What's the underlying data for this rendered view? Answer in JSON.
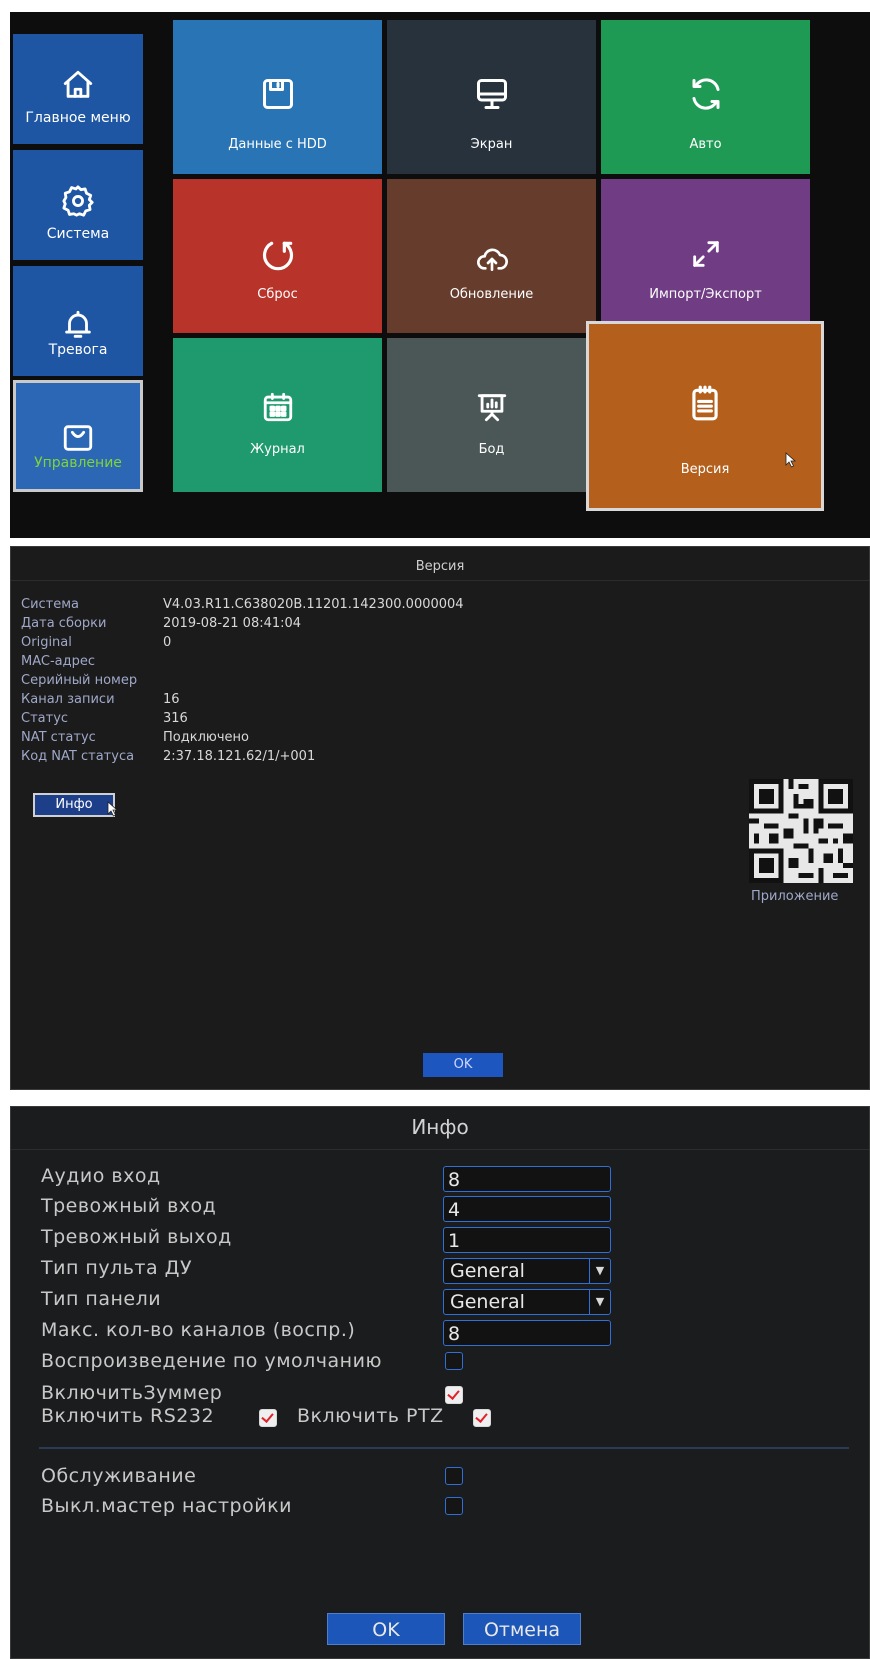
{
  "menu": {
    "sidebar": [
      {
        "label": "Главное меню",
        "icon": "home-icon"
      },
      {
        "label": "Система",
        "icon": "gear-icon"
      },
      {
        "label": "Тревога",
        "icon": "bell-icon"
      },
      {
        "label": "Управление",
        "icon": "bag-icon",
        "active": true
      }
    ],
    "tiles": [
      {
        "label": "Данные с HDD",
        "icon": "floppy-disk-icon",
        "color": "#2874b4"
      },
      {
        "label": "Экран",
        "icon": "monitor-icon",
        "color": "#27323d"
      },
      {
        "label": "Авто",
        "icon": "sync-icon",
        "color": "#1f9a55"
      },
      {
        "label": "Сброс",
        "icon": "reset-icon",
        "color": "#b8342b"
      },
      {
        "label": "Обновление",
        "icon": "cloud-upload-icon",
        "color": "#663c2d"
      },
      {
        "label": "Импорт/Экспорт",
        "icon": "expand-arrows-icon",
        "color": "#703d85"
      },
      {
        "label": "Журнал",
        "icon": "calendar-icon",
        "color": "#1f9a6e"
      },
      {
        "label": "Бод",
        "icon": "presentation-chart-icon",
        "color": "#4b5656"
      },
      {
        "label": "Версия",
        "icon": "clipboard-icon",
        "color": "#b4601c",
        "selected": true
      }
    ]
  },
  "version": {
    "title": "Версия",
    "rows": [
      {
        "key": "Система",
        "value": "V4.03.R11.C638020B.11201.142300.0000004"
      },
      {
        "key": "Дата сборки",
        "value": "2019-08-21 08:41:04"
      },
      {
        "key": "Original",
        "value": "0"
      },
      {
        "key": "MAC-адрес",
        "value": ""
      },
      {
        "key": "Серийный номер",
        "value": ""
      },
      {
        "key": "Канал записи",
        "value": "16"
      },
      {
        "key": "Статус",
        "value": "316"
      },
      {
        "key": "NAT статус",
        "value": "Подключено"
      },
      {
        "key": "Код NAT статуса",
        "value": "2:37.18.121.62/1/+001"
      }
    ],
    "info_button": "Инфо",
    "qr_label": "Приложение",
    "ok_button": "OK"
  },
  "info": {
    "title": "Инфо",
    "audio_in": {
      "label": "Аудио вход",
      "value": "8"
    },
    "alarm_in": {
      "label": "Тревожный вход",
      "value": "4"
    },
    "alarm_out": {
      "label": "Тревожный выход",
      "value": "1"
    },
    "remote_type": {
      "label": "Тип пульта ДУ",
      "value": "General"
    },
    "panel_type": {
      "label": "Тип панели",
      "value": "General"
    },
    "max_channels": {
      "label": "Макс. кол-во каналов (воспр.)",
      "value": "8"
    },
    "default_playback": {
      "label": "Воспроизведение по умолчанию",
      "checked": false
    },
    "buzzer": {
      "label": "ВключитьЗуммер",
      "checked": true
    },
    "rs232": {
      "label": "Включить RS232",
      "checked": true
    },
    "ptz": {
      "label": "Включить PTZ",
      "checked": true
    },
    "maintenance": {
      "label": "Обслуживание",
      "checked": false
    },
    "wizard_off": {
      "label": "Выкл.мастер настройки",
      "checked": false
    },
    "ok_button": "OK",
    "cancel_button": "Отмена"
  }
}
